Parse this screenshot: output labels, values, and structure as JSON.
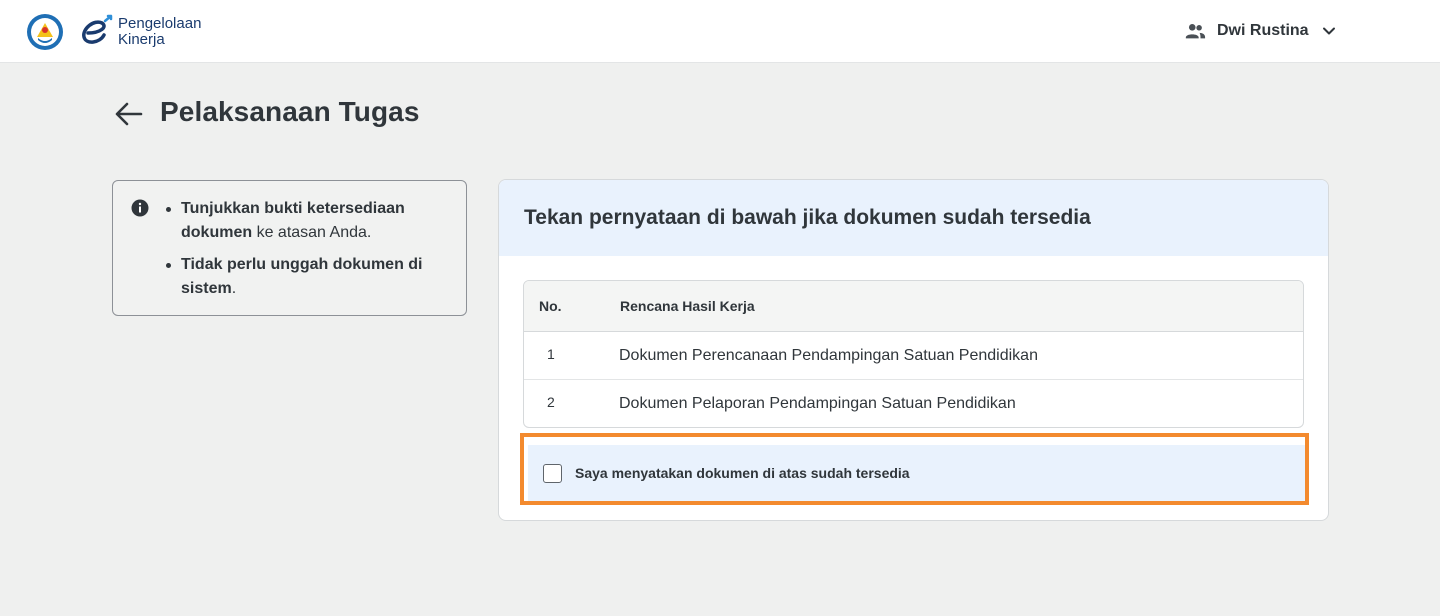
{
  "header": {
    "app_name_line1": "Pengelolaan",
    "app_name_line2": "Kinerja",
    "user_name": "Dwi Rustina",
    "icons": {
      "emblem": "tut-wuri-handayani-emblem",
      "user": "people-icon",
      "menu": "chevron-down-icon"
    }
  },
  "page": {
    "title": "Pelaksanaan Tugas",
    "back_icon": "arrow-left-icon"
  },
  "info_box": {
    "icon": "info-icon",
    "item1_bold": "Tunjukkan bukti ketersediaan dokumen",
    "item1_rest": " ke atasan Anda.",
    "item2_bold": "Tidak perlu unggah dokumen di sistem",
    "item2_rest": "."
  },
  "card": {
    "title": "Tekan pernyataan di bawah jika dokumen sudah tersedia",
    "table": {
      "columns": [
        "No.",
        "Rencana Hasil Kerja"
      ],
      "rows": [
        {
          "no": "1",
          "rhk": "Dokumen Perencanaan Pendampingan Satuan Pendidikan"
        },
        {
          "no": "2",
          "rhk": "Dokumen Pelaporan Pendampingan Satuan Pendidikan"
        }
      ]
    },
    "statement": {
      "label": "Saya menyatakan dokumen di atas sudah tersedia",
      "checked": false
    }
  },
  "colors": {
    "highlight_border": "#f38a2e",
    "card_header_bg": "#e9f2fd",
    "page_bg": "#eff0ef",
    "brand_blue": "#1a3b6e"
  }
}
